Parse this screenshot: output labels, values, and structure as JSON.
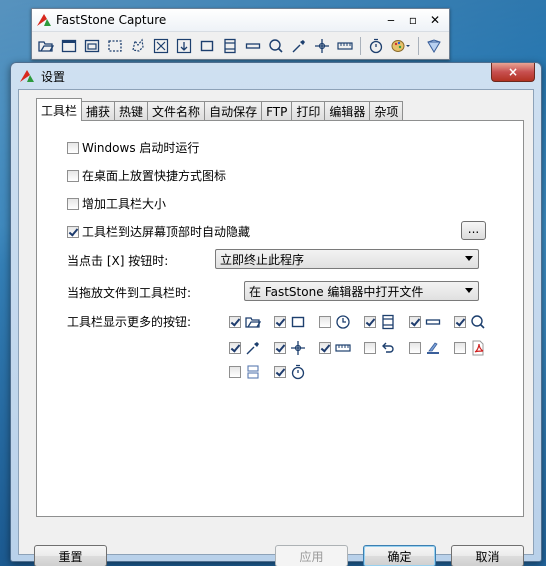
{
  "toolbar_window": {
    "title": "FastStone Capture",
    "controls": [
      "-",
      "□",
      "×"
    ],
    "icons": [
      "open-folder-icon",
      "active-window-icon",
      "window-object-icon",
      "rectangle-region-icon",
      "freehand-region-icon",
      "full-screen-icon",
      "scrolling-window-icon",
      "fixed-region-icon",
      "video-recorder-icon",
      "minus-icon",
      "magnifier-icon",
      "color-picker-icon",
      "crosshair-icon",
      "ruler-icon",
      "timer-icon",
      "output-menu-icon",
      "settings-icon"
    ]
  },
  "dialog": {
    "title": "设置",
    "close_label": "×",
    "tabs": [
      "工具栏",
      "捕获",
      "热键",
      "文件名称",
      "自动保存",
      "FTP",
      "打印",
      "编辑器",
      "杂项"
    ],
    "active_tab": "工具栏",
    "options": [
      {
        "label": "Windows 启动时运行",
        "checked": false
      },
      {
        "label": "在桌面上放置快捷方式图标",
        "checked": false
      },
      {
        "label": "增加工具栏大小",
        "checked": false
      },
      {
        "label": "工具栏到达屏幕顶部时自动隐藏",
        "checked": true
      }
    ],
    "dots_button": "...",
    "close_click_label": "当点击 [X] 按钮时:",
    "close_click_value": "立即终止此程序",
    "drop_label": "当拖放文件到工具栏时:",
    "drop_value": "在 FastStone 编辑器中打开文件",
    "more_buttons_label": "工具栏显示更多的按钮:",
    "more_buttons": [
      [
        {
          "icon": "open-folder-icon",
          "checked": true
        },
        {
          "icon": "fixed-region-icon",
          "checked": true
        },
        {
          "icon": "clock-icon",
          "checked": false
        },
        {
          "icon": "film-icon",
          "checked": true
        },
        {
          "icon": "minus-bar-icon",
          "checked": true
        },
        {
          "icon": "magnifier-icon",
          "checked": true
        }
      ],
      [
        {
          "icon": "color-picker-icon",
          "checked": true
        },
        {
          "icon": "crosshair-icon",
          "checked": true
        },
        {
          "icon": "ruler-icon",
          "checked": true
        },
        {
          "icon": "undo-arrow-icon",
          "checked": false
        },
        {
          "icon": "scanner-icon",
          "checked": false
        },
        {
          "icon": "pdf-icon",
          "checked": false
        }
      ],
      [
        {
          "icon": "split-window-icon",
          "checked": false
        },
        {
          "icon": "timer-icon",
          "checked": true
        }
      ]
    ],
    "buttons": {
      "reset": "重置",
      "apply": "应用",
      "ok": "确定",
      "cancel": "取消"
    }
  }
}
